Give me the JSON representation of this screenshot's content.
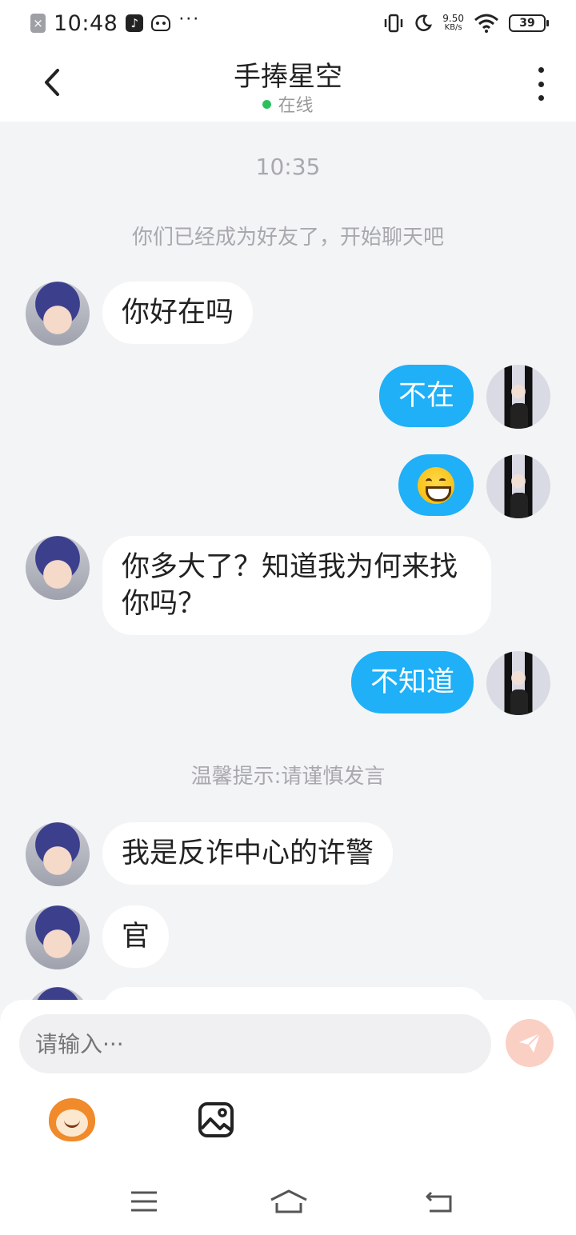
{
  "status_bar": {
    "time": "10:48",
    "net_speed_value": "9.50",
    "net_speed_unit": "KB/s",
    "battery": "39"
  },
  "header": {
    "title": "手捧星空",
    "status": "在线"
  },
  "chat": {
    "timestamp": "10:35",
    "system_notice": "你们已经成为好友了，开始聊天吧",
    "tip_notice": "温馨提示:请谨慎发言",
    "messages": [
      {
        "side": "in",
        "text": "你好在吗"
      },
      {
        "side": "out",
        "text": "不在"
      },
      {
        "side": "out",
        "text": "😄"
      },
      {
        "side": "in",
        "text": "你多大了？知道我为何来找你吗？"
      },
      {
        "side": "out",
        "text": "不知道"
      },
      {
        "side": "in",
        "text": "我是反诈中心的许警"
      },
      {
        "side": "in",
        "text": "官"
      }
    ]
  },
  "input": {
    "placeholder": "请输入···"
  },
  "icons": {
    "back": "chevron-left-icon",
    "more": "more-vertical-icon",
    "send": "send-icon",
    "sticker": "monkey-sticker-icon",
    "image": "image-icon"
  },
  "colors": {
    "outgoing_bubble": "#1fb0f7",
    "online_dot": "#2ac15c",
    "send_button_disabled": "#fbd0c4"
  }
}
